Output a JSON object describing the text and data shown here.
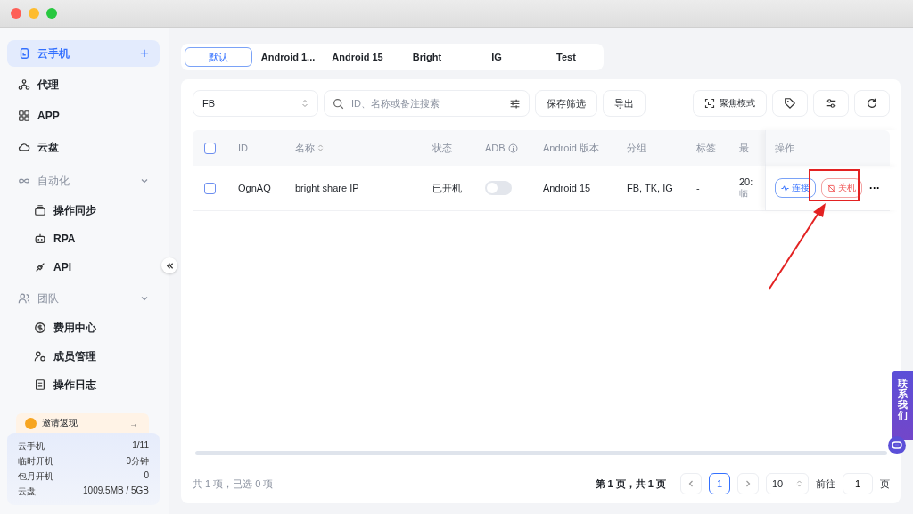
{
  "sidebar": {
    "items": [
      {
        "kind": "item",
        "label": "云手机",
        "selected": true,
        "add": "+"
      },
      {
        "kind": "item",
        "label": "代理",
        "selected": false
      },
      {
        "kind": "item",
        "label": "APP",
        "selected": false
      },
      {
        "kind": "item",
        "label": "云盘",
        "selected": false
      },
      {
        "kind": "group",
        "label": "自动化",
        "expanded": true,
        "children": [
          {
            "label": "操作同步",
            "selected": false
          },
          {
            "label": "RPA",
            "selected": false
          },
          {
            "label": "API",
            "selected": false
          }
        ]
      },
      {
        "kind": "group",
        "label": "团队",
        "expanded": true,
        "children": [
          {
            "label": "费用中心",
            "selected": false
          },
          {
            "label": "成员管理",
            "selected": false
          },
          {
            "label": "操作日志",
            "selected": false
          }
        ]
      }
    ],
    "invite": {
      "label": "邀请返现",
      "arrow": "→"
    },
    "usage": [
      {
        "label": "云手机",
        "value": "1/11"
      },
      {
        "label": "临时开机",
        "value": "0分钟"
      },
      {
        "label": "包月开机",
        "value": "0"
      },
      {
        "label": "云盘",
        "value": "1009.5MB / 5GB"
      }
    ]
  },
  "tabs": [
    {
      "label": "默认",
      "selected": true
    },
    {
      "label": "Android 1...",
      "selected": false
    },
    {
      "label": "Android 15",
      "selected": false
    },
    {
      "label": "Bright",
      "selected": false
    },
    {
      "label": "IG",
      "selected": false
    },
    {
      "label": "Test",
      "selected": false
    }
  ],
  "toolbar": {
    "group_select": "FB",
    "search": {
      "placeholder": "ID、名称或备注搜索"
    },
    "buttons": [
      "保存筛选",
      "导出"
    ],
    "focus_mode": "聚焦模式"
  },
  "table": {
    "columns": [
      "ID",
      "名称",
      "状态",
      "ADB",
      "Android 版本",
      "分组",
      "标签",
      "最",
      "操作"
    ],
    "rows": [
      {
        "checked": false,
        "id": "OgnAQ",
        "name": "bright share IP",
        "status": "已开机",
        "adb_on": false,
        "android": "Android 15",
        "groups": "FB, TK, IG",
        "tags": "-",
        "last_line1": "20:",
        "last_line2": "临",
        "connect": "连接",
        "shutdown": "关机",
        "more": "···"
      }
    ]
  },
  "header_checked": false,
  "footer": {
    "summary": "共 1 项，已选 0 项",
    "page_info": "第 1 页，共 1 页",
    "pages": [
      {
        "label": "1",
        "selected": true
      }
    ],
    "page_size": "10",
    "goto_label": "前往",
    "goto_value": "1",
    "page_suffix": "页"
  },
  "contact": {
    "label": "联系我们"
  }
}
